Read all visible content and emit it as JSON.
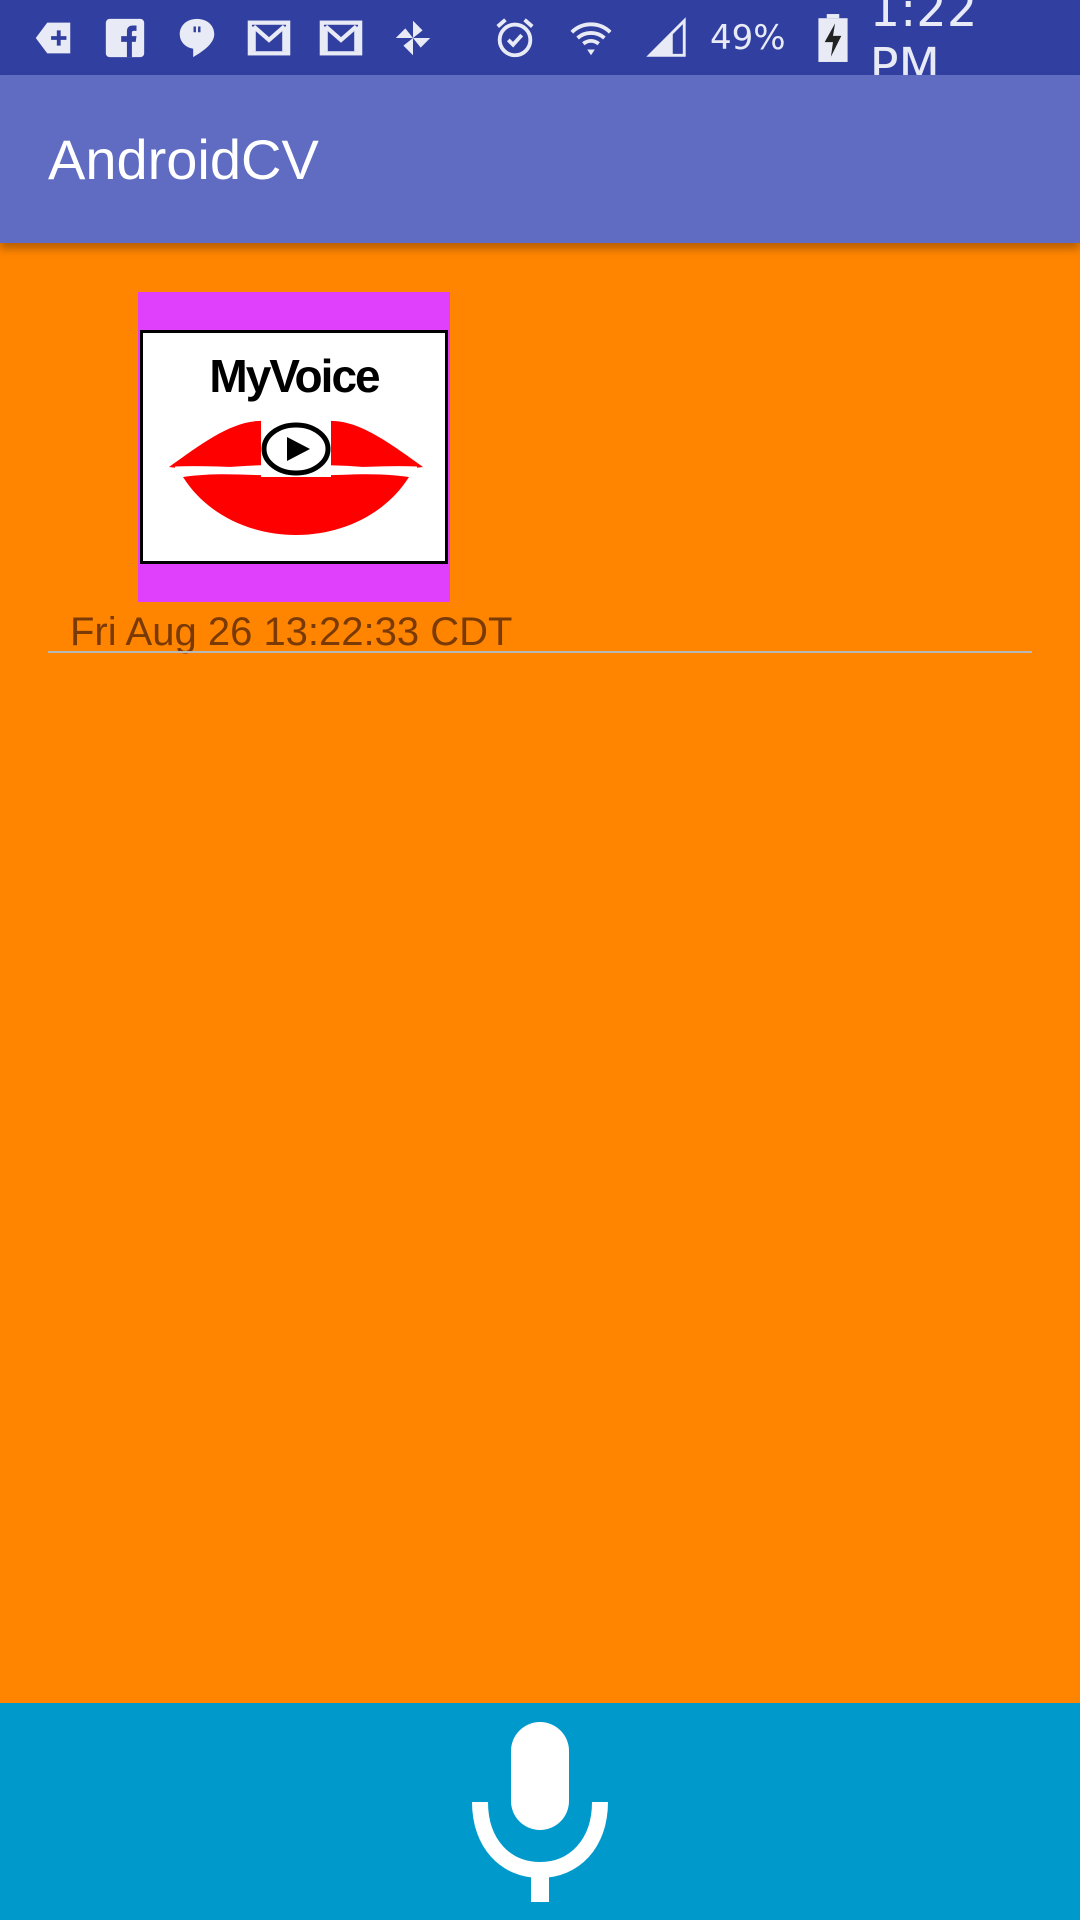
{
  "status_bar": {
    "left_icons": [
      "add-box-icon",
      "facebook-icon",
      "quote-bubble-icon",
      "gmail-icon",
      "gmail-icon",
      "pinwheel-icon"
    ],
    "right_icons": [
      "alarm-icon",
      "wifi-icon",
      "signal-icon"
    ],
    "battery_percent": "49%",
    "time": "1:22 PM"
  },
  "app_bar": {
    "title": "AndroidCV"
  },
  "list": {
    "items": [
      {
        "logo_text": "MyVoice",
        "timestamp": "Fri Aug 26 13:22:33 CDT"
      }
    ]
  },
  "bottom_bar": {
    "icon": "microphone-icon"
  },
  "colors": {
    "status_bar": "#3140a0",
    "app_bar": "#5f6cc1",
    "background": "#ff8500",
    "card_frame": "#e040fb",
    "bottom_bar": "#0099cc",
    "lips": "#ff0000"
  }
}
